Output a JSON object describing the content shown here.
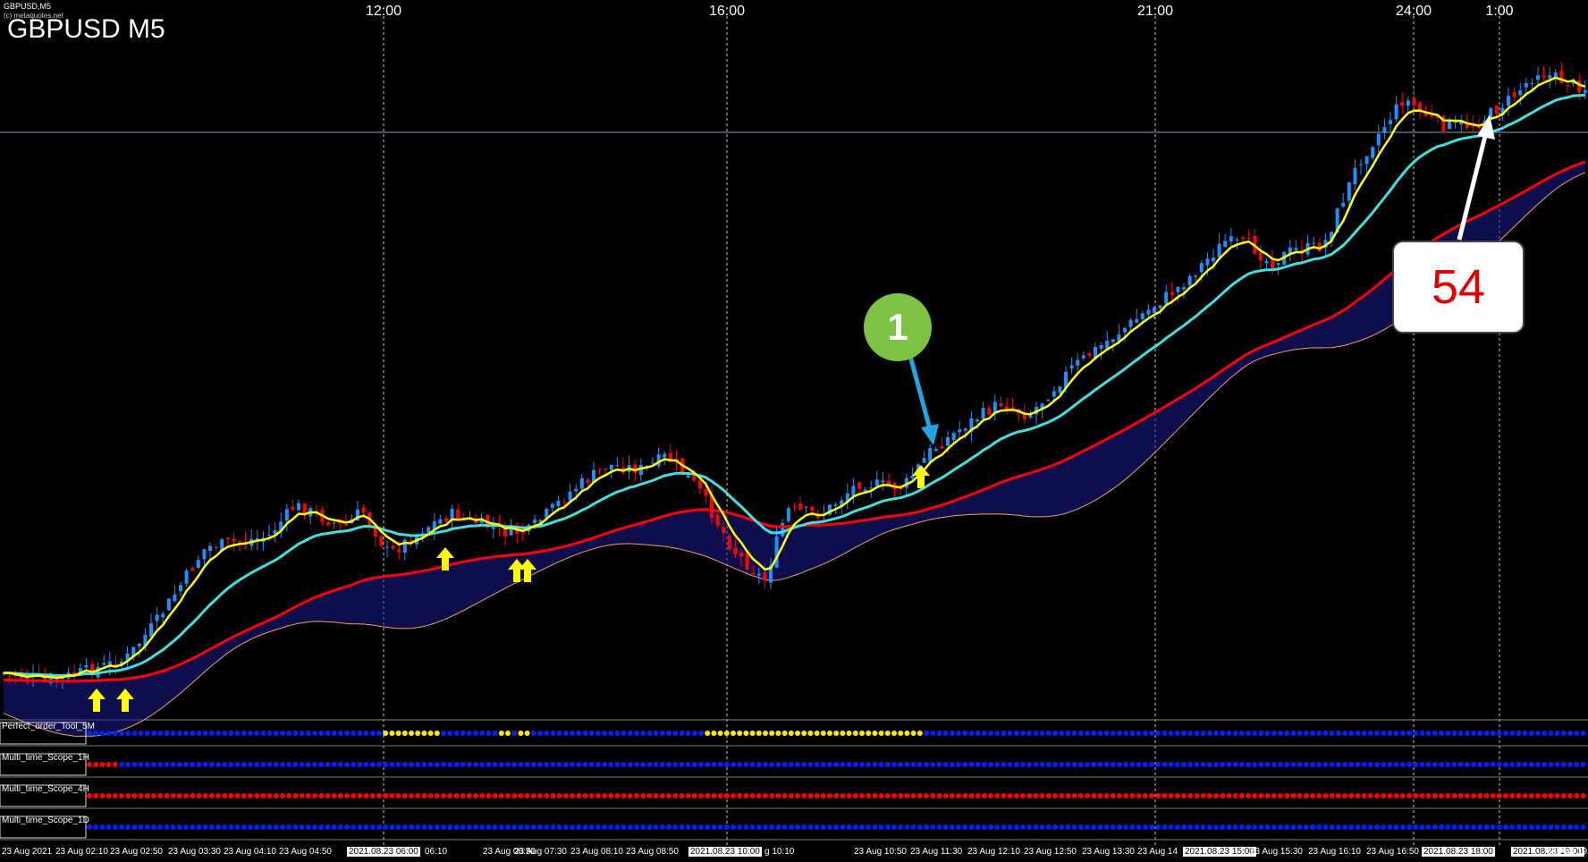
{
  "window": {
    "tab_title": "GBPUSD,M5",
    "copyright": "(c) metaquotes.net",
    "chart_title": "GBPUSD M5"
  },
  "time_labels_top": [
    "12:00",
    "16:00",
    "21:00",
    "24:00",
    "1:00"
  ],
  "panels": [
    {
      "name": "Perfect_order_Tool_5M",
      "dot_colors": [
        "#0020ff",
        "#ffe800"
      ]
    },
    {
      "name": "Multi_time_Scope_1H",
      "dot_colors": [
        "#0020ff",
        "#ff0000"
      ]
    },
    {
      "name": "Multi_time_Scope_4H",
      "dot_colors": [
        "#ff0000"
      ]
    },
    {
      "name": "Multi_time_Scope_1D",
      "dot_colors": [
        "#0020ff"
      ]
    }
  ],
  "bottom_labels": [
    {
      "text": "23 Aug 2021",
      "boxed": false
    },
    {
      "text": "23 Aug 02:10",
      "boxed": false
    },
    {
      "text": "23 Aug 02:50",
      "boxed": false
    },
    {
      "text": "23 Aug 03:30",
      "boxed": false
    },
    {
      "text": "23 Aug 04:10",
      "boxed": false
    },
    {
      "text": "23 Aug 04:50",
      "boxed": false
    },
    {
      "text": "2021.08.23 06:00",
      "boxed": true
    },
    {
      "text": "06:10",
      "boxed": false
    },
    {
      "text": "23 Aug 06:50",
      "boxed": false
    },
    {
      "text": "23 Aug 07:30",
      "boxed": false
    },
    {
      "text": "23 Aug 08:10",
      "boxed": false
    },
    {
      "text": "23 Aug 08:50",
      "boxed": false
    },
    {
      "text": "2021.08.23 10:00",
      "boxed": true
    },
    {
      "text": "g 10:10",
      "boxed": false
    },
    {
      "text": "23 Aug 10:50",
      "boxed": false
    },
    {
      "text": "23 Aug 11:30",
      "boxed": false
    },
    {
      "text": "23 Aug 12:10",
      "boxed": false
    },
    {
      "text": "23 Aug 12:50",
      "boxed": false
    },
    {
      "text": "23 Aug 13:30",
      "boxed": false
    },
    {
      "text": "23 Aug 14",
      "boxed": false
    },
    {
      "text": "2021.08.23 15:00",
      "boxed": true
    },
    {
      "text": "23 Aug 15:30",
      "boxed": false
    },
    {
      "text": "23 Aug 16:10",
      "boxed": false
    },
    {
      "text": "23 Aug 16:50",
      "boxed": false
    },
    {
      "text": "2021.08.23 18:00",
      "boxed": true
    },
    {
      "text": "2021.08.23 19:00",
      "boxed": true
    },
    {
      "text": "23 Aug 19:3",
      "boxed": false
    }
  ],
  "annotations": {
    "marker_label": "1",
    "callout_label": "54"
  },
  "colors": {
    "background": "#000000",
    "bull_candle": "#1e90ff",
    "bear_candle": "#ff0000",
    "ma_fast": "#ffff00",
    "ma_mid": "#40e0e0",
    "ma_slow": "#ff0000",
    "cloud": "#1a1a8c",
    "signal_arrow": "#ffff00",
    "marker_green": "#7dc242",
    "arrow_blue": "#1ea7e0"
  }
}
